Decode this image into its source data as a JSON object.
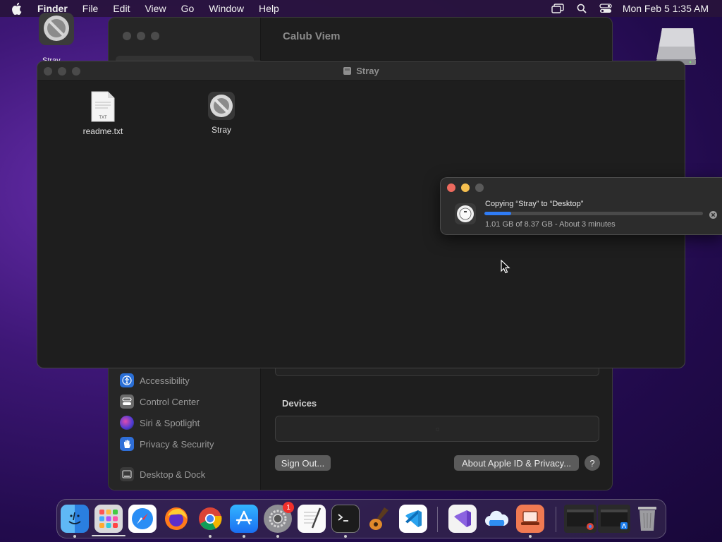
{
  "menubar": {
    "app": "Finder",
    "items": [
      "File",
      "Edit",
      "View",
      "Go",
      "Window",
      "Help"
    ],
    "clock": "Mon Feb 5  1:35 AM",
    "icons": [
      "screen-mirroring-icon",
      "search-icon",
      "control-center-icon"
    ]
  },
  "desktop": {
    "stray_label": "Stray"
  },
  "settings": {
    "pane_title": "Calub Viem",
    "sidebar": [
      {
        "label": "Accessibility",
        "icon": "accessibility-icon",
        "color": "#2a6fd6"
      },
      {
        "label": "Control Center",
        "icon": "control-center-icon",
        "color": "#6b6b6b"
      },
      {
        "label": "Siri & Spotlight",
        "icon": "siri-icon",
        "color": "#b0388f"
      },
      {
        "label": "Privacy & Security",
        "icon": "hand-icon",
        "color": "#2f6fd8"
      },
      {
        "label": "Desktop & Dock",
        "icon": "dock-icon",
        "color": "#3a3a3a"
      }
    ],
    "devices_title": "Devices",
    "sign_out": "Sign Out...",
    "about": "About Apple ID & Privacy...",
    "help": "?"
  },
  "finder": {
    "title": "Stray",
    "files": [
      {
        "name": "readme.txt",
        "badge": "TXT",
        "icon": "text-file-icon"
      },
      {
        "name": "Stray",
        "icon": "app-disk-icon"
      }
    ]
  },
  "copy_dialog": {
    "heading": "Copying “Stray” to “Desktop”",
    "status": "1.01 GB of 8.37 GB - About 3 minutes",
    "progress_fraction": 0.121,
    "colors": {
      "close": "#ed6a5e",
      "minimize": "#f5bf4f",
      "zoom": "#5a5a5a",
      "progress": "#2f7cf6"
    }
  },
  "dock": {
    "apps": [
      "finder-icon",
      "launchpad-icon",
      "safari-icon",
      "firefox-icon",
      "chrome-icon",
      "app-store-icon",
      "system-settings-icon",
      "textedit-icon",
      "terminal-icon",
      "garageband-icon",
      "vscode-icon",
      "visual-studio-icon",
      "icloud-icon",
      "remote-desktop-icon",
      "recent-window-icon",
      "recent-window-2-icon",
      "trash-icon"
    ],
    "settings_badge": "1"
  }
}
